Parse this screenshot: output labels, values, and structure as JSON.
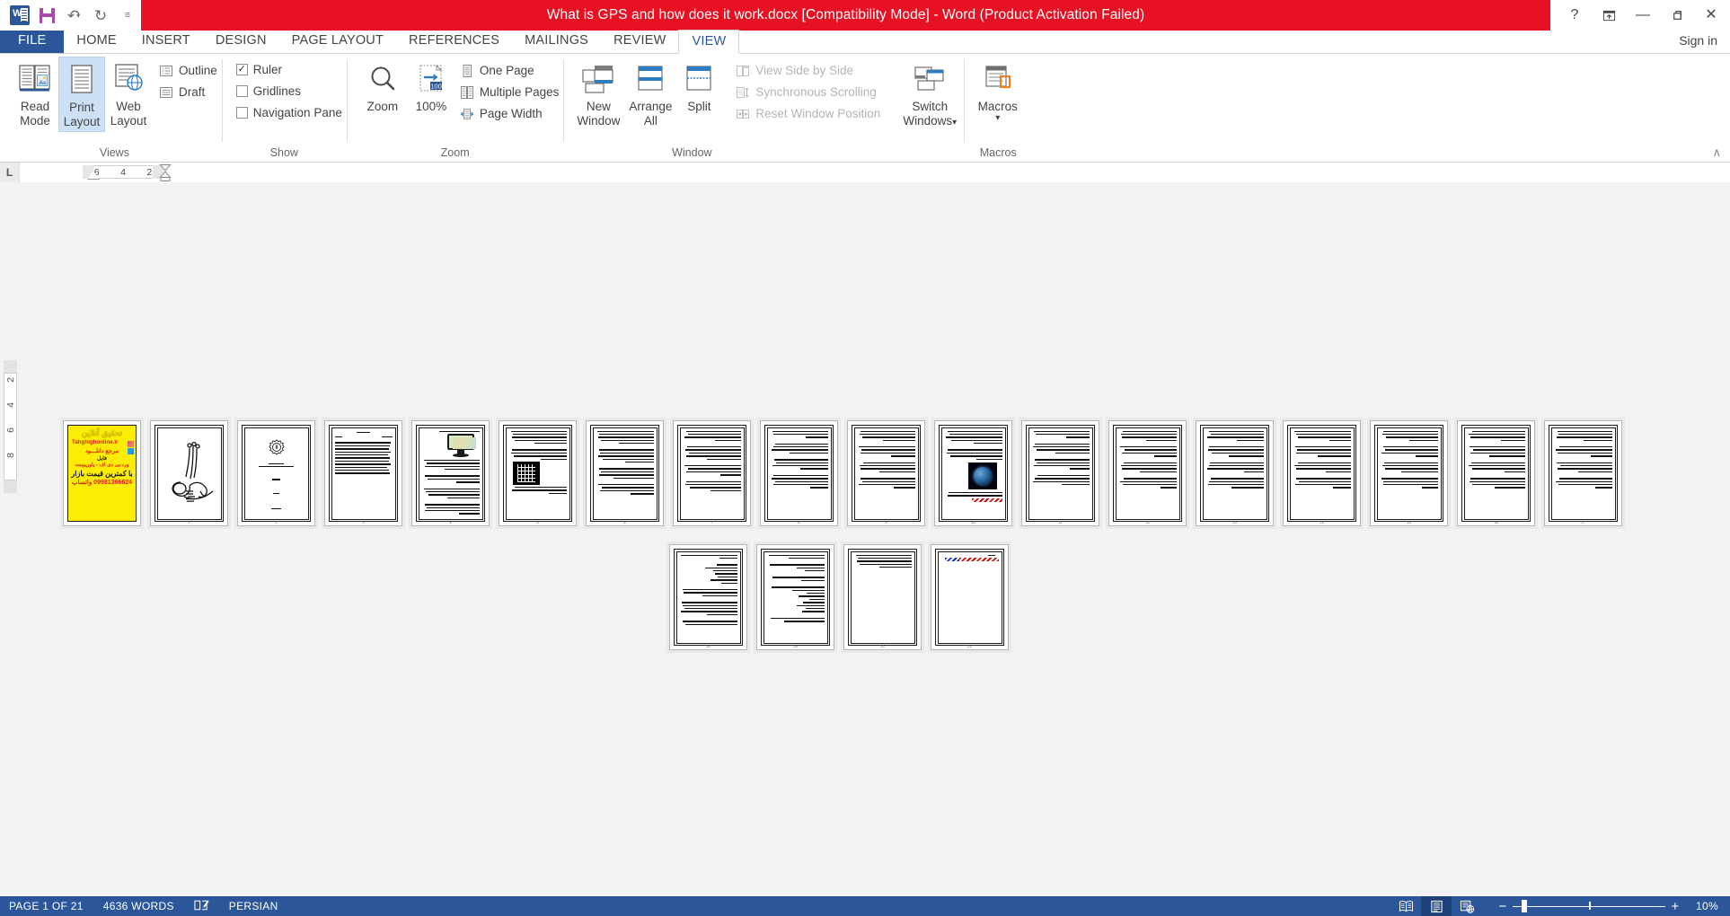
{
  "titlebar": {
    "app_icon": "word-logo-icon",
    "quick_access": [
      {
        "name": "save-button",
        "icon": "save-icon",
        "label": "Save"
      },
      {
        "name": "undo-button",
        "icon": "undo-arrow-icon",
        "label": "Undo"
      },
      {
        "name": "redo-button",
        "icon": "redo-arrow-icon",
        "label": "Repeat"
      },
      {
        "name": "customize-qat-button",
        "icon": "chevron-down-icon",
        "label": "Customize Quick Access Toolbar"
      }
    ],
    "document_title": "What is GPS and how does it work.docx [Compatibility Mode]  -  Word (Product Activation Failed)",
    "help_glyph": "?",
    "ribbon_display_glyph": "⤒",
    "minimize_glyph": "—",
    "restore_glyph": "❐",
    "close_glyph": "✕",
    "sign_in": "Sign in"
  },
  "tabs": [
    {
      "label": "FILE",
      "active": false,
      "file": true
    },
    {
      "label": "HOME",
      "active": false,
      "file": false
    },
    {
      "label": "INSERT",
      "active": false,
      "file": false
    },
    {
      "label": "DESIGN",
      "active": false,
      "file": false
    },
    {
      "label": "PAGE LAYOUT",
      "active": false,
      "file": false
    },
    {
      "label": "REFERENCES",
      "active": false,
      "file": false
    },
    {
      "label": "MAILINGS",
      "active": false,
      "file": false
    },
    {
      "label": "REVIEW",
      "active": false,
      "file": false
    },
    {
      "label": "VIEW",
      "active": true,
      "file": false
    }
  ],
  "ribbon": {
    "collapse_glyph": "∧",
    "groups": {
      "views": {
        "label": "Views",
        "read_mode": "Read\nMode",
        "read_mode_l1": "Read",
        "read_mode_l2": "Mode",
        "print_layout_l1": "Print",
        "print_layout_l2": "Layout",
        "web_layout_l1": "Web",
        "web_layout_l2": "Layout",
        "outline": "Outline",
        "draft": "Draft"
      },
      "show": {
        "label": "Show",
        "ruler": "Ruler",
        "ruler_checked": true,
        "gridlines": "Gridlines",
        "gridlines_checked": false,
        "navigation_pane": "Navigation Pane",
        "navigation_pane_checked": false
      },
      "zoom": {
        "label": "Zoom",
        "zoom_button": "Zoom",
        "hundred_percent": "100%",
        "hundred_badge": "100",
        "one_page": "One Page",
        "multiple_pages": "Multiple Pages",
        "page_width": "Page Width"
      },
      "window": {
        "label": "Window",
        "new_window_l1": "New",
        "new_window_l2": "Window",
        "arrange_all_l1": "Arrange",
        "arrange_all_l2": "All",
        "split": "Split",
        "view_side_by_side": "View Side by Side",
        "synchronous_scrolling": "Synchronous Scrolling",
        "reset_window_position": "Reset Window Position",
        "switch_windows_l1": "Switch",
        "switch_windows_l2": "Windows",
        "dropdown_glyph": "▾"
      },
      "macros": {
        "label": "Macros",
        "macros_button": "Macros",
        "dropdown_glyph": "▾"
      }
    }
  },
  "rulers": {
    "tab_selector_glyph": "L",
    "horizontal_ticks": [
      "6",
      "4",
      "2"
    ],
    "vertical_ticks": [
      "2",
      "4",
      "6",
      "8"
    ]
  },
  "document": {
    "page1_ad": {
      "title": "تحقیق آنلاین",
      "site": "Tahghighonline.ir",
      "line2": "مرجع دانلـــود",
      "line3": "فایل",
      "line4": "ورد-پی دی اف - پاورپوینت",
      "line5": "با کمترین قیمت بازار",
      "line6": "09981366624 واتساپ"
    },
    "page_numbers_visible": true
  },
  "statusbar": {
    "page_indicator": "PAGE 1 OF 21",
    "word_count": "4636 WORDS",
    "proofing_icon": "proofing-errors-icon",
    "language": "PERSIAN",
    "view_read_mode_icon": "read-mode-icon",
    "view_print_layout_icon": "print-layout-icon",
    "view_web_layout_icon": "web-layout-icon",
    "zoom_minus": "−",
    "zoom_plus": "+",
    "zoom_level": "10%"
  },
  "colors": {
    "title_red": "#e81123",
    "office_blue": "#2b579a",
    "accent_selected": "#cde0f5",
    "workspace_gray": "#f2f2f2"
  }
}
